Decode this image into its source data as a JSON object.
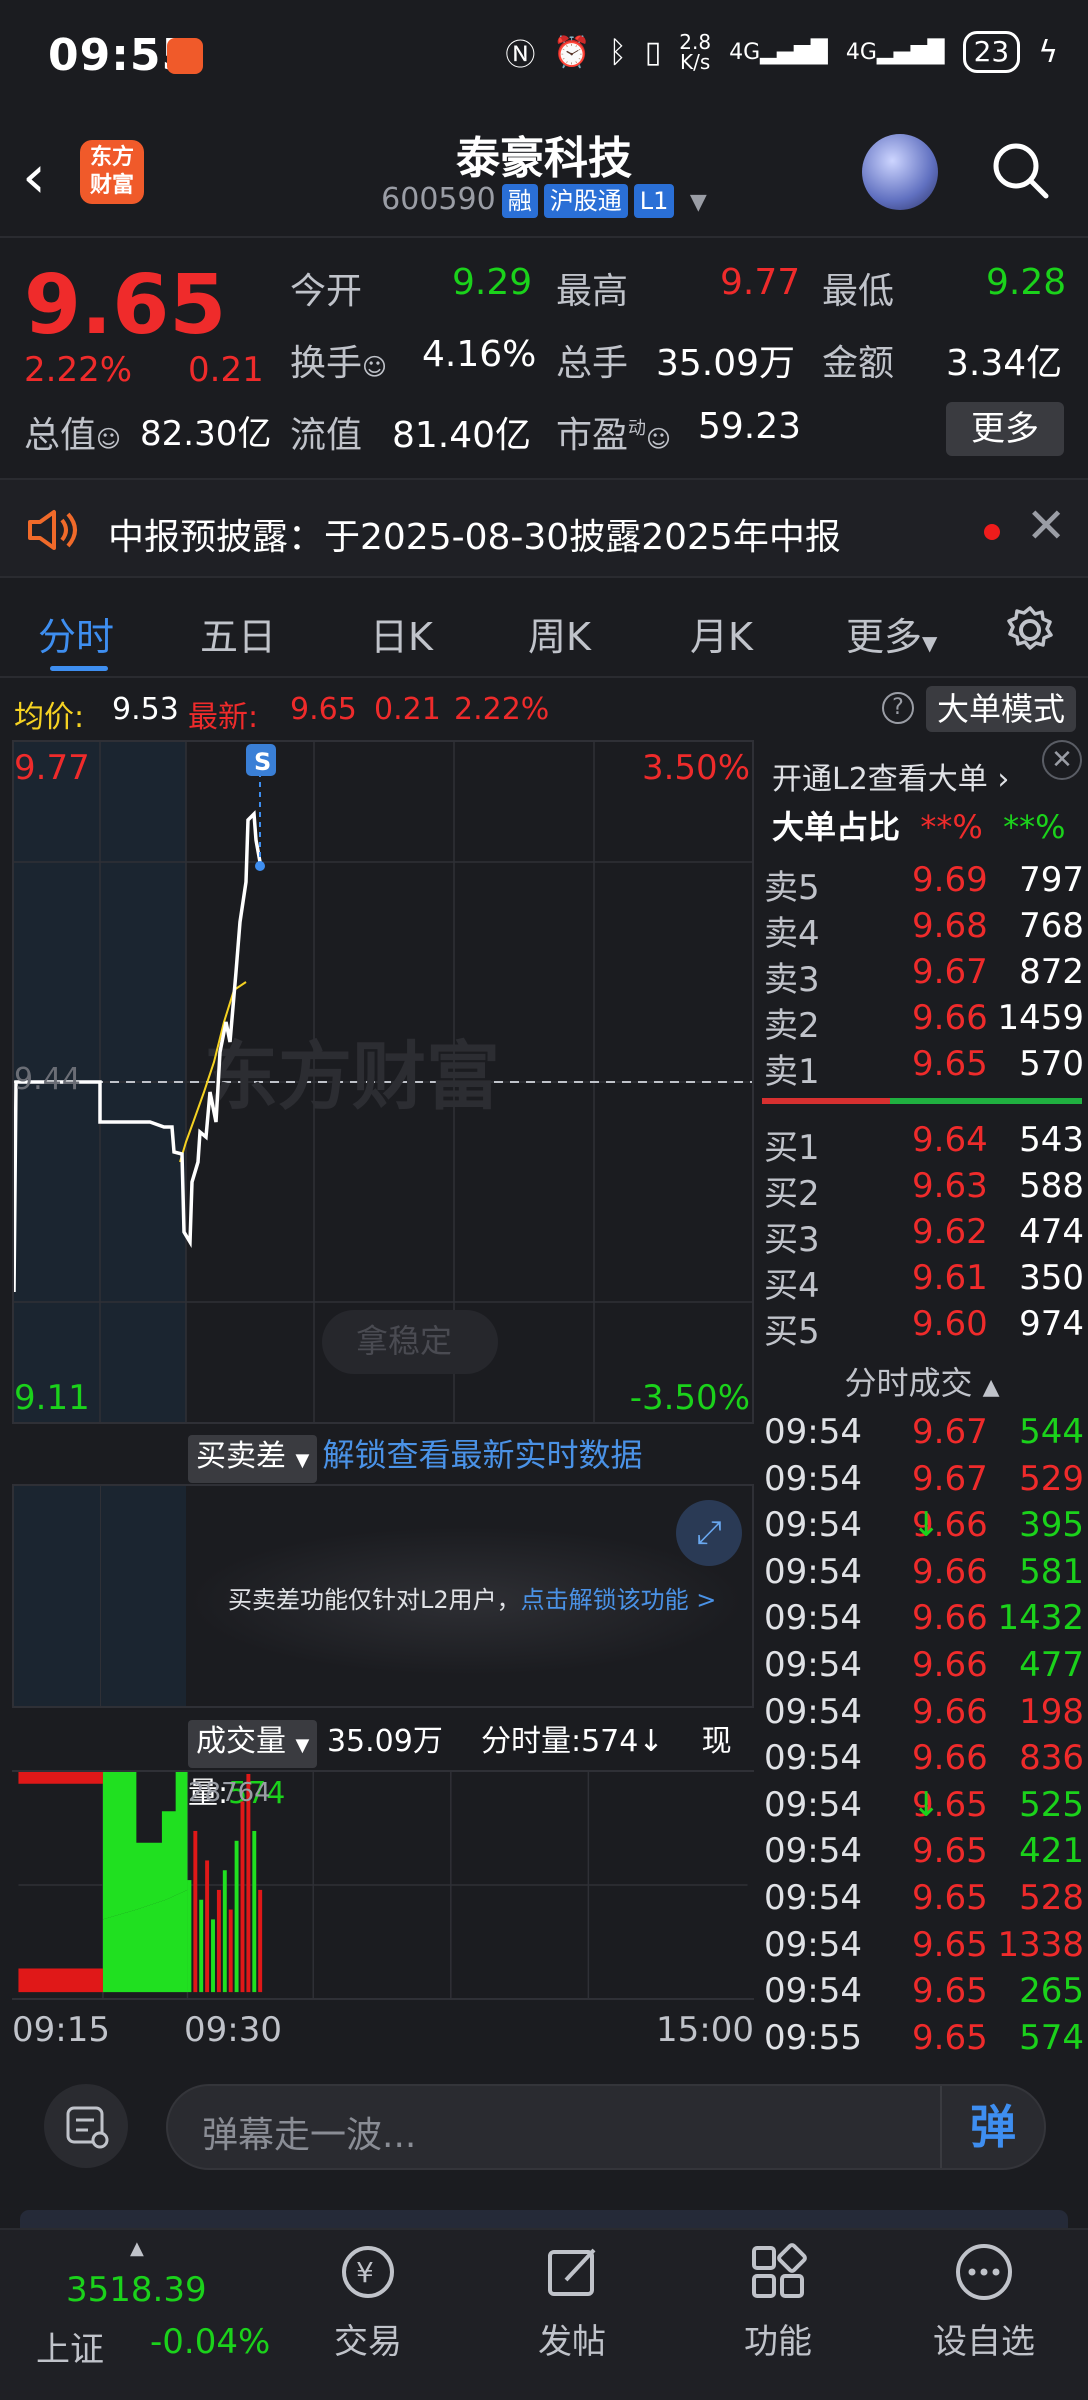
{
  "status": {
    "time": "09:55",
    "speed_top": "2.8",
    "speed_unit": "K/s",
    "signal1": "4G",
    "signal2": "4G",
    "battery": "23"
  },
  "header": {
    "logo_line1": "东方",
    "logo_line2": "财富",
    "stock_name": "泰豪科技",
    "stock_code": "600590",
    "tag1": "融",
    "tag2": "沪股通",
    "tag3": "L1"
  },
  "quote": {
    "price": "9.65",
    "pct": "2.22%",
    "change": "0.21",
    "open_label": "今开",
    "open": "9.29",
    "high_label": "最高",
    "high": "9.77",
    "low_label": "最低",
    "low": "9.28",
    "turnover_label": "换手",
    "turnover": "4.16%",
    "volume_label": "总手",
    "volume": "35.09万",
    "amount_label": "金额",
    "amount": "3.34亿",
    "mktcap_label": "总值",
    "mktcap": "82.30亿",
    "float_label": "流值",
    "float": "81.40亿",
    "pe_label": "市盈",
    "pe_sup": "动",
    "pe": "59.23",
    "more": "更多"
  },
  "notice": {
    "text": "中报预披露：于2025-08-30披露2025年中报"
  },
  "tabs": [
    "分时",
    "五日",
    "日K",
    "周K",
    "月K",
    "更多"
  ],
  "infobar": {
    "avg_label": "均价:",
    "avg": "9.53",
    "last_label": "最新:",
    "last": "9.65",
    "chg": "0.21",
    "pct": "2.22%",
    "big_mode": "大单模式"
  },
  "chart": {
    "top_price": "9.77",
    "top_pct": "3.50%",
    "mid_price": "9.44",
    "bottom_price": "9.11",
    "bottom_pct": "-3.50%",
    "watermark": "东方财富",
    "stabilize": "拿稳定",
    "s_marker": "S"
  },
  "l2": {
    "open_l2": "开通L2查看大单",
    "big_ratio": "大单占比",
    "big_red": "**%",
    "big_green": "**%"
  },
  "orderbook": {
    "asks": [
      {
        "label": "卖5",
        "price": "9.69",
        "qty": "797"
      },
      {
        "label": "卖4",
        "price": "9.68",
        "qty": "768"
      },
      {
        "label": "卖3",
        "price": "9.67",
        "qty": "872"
      },
      {
        "label": "卖2",
        "price": "9.66",
        "qty": "1459"
      },
      {
        "label": "卖1",
        "price": "9.65",
        "qty": "570"
      }
    ],
    "bids": [
      {
        "label": "买1",
        "price": "9.64",
        "qty": "543"
      },
      {
        "label": "买2",
        "price": "9.63",
        "qty": "588"
      },
      {
        "label": "买3",
        "price": "9.62",
        "qty": "474"
      },
      {
        "label": "买4",
        "price": "9.61",
        "qty": "350"
      },
      {
        "label": "买5",
        "price": "9.60",
        "qty": "974"
      }
    ]
  },
  "trades_title": "分时成交",
  "trades": [
    {
      "time": "09:54",
      "price": "9.67",
      "arrow": "",
      "qty": "544",
      "qcolor": "green"
    },
    {
      "time": "09:54",
      "price": "9.67",
      "arrow": "",
      "qty": "529",
      "qcolor": "red"
    },
    {
      "time": "09:54",
      "price": "9.66",
      "arrow": "↓",
      "qty": "395",
      "qcolor": "green"
    },
    {
      "time": "09:54",
      "price": "9.66",
      "arrow": "",
      "qty": "581",
      "qcolor": "green"
    },
    {
      "time": "09:54",
      "price": "9.66",
      "arrow": "",
      "qty": "1432",
      "qcolor": "green"
    },
    {
      "time": "09:54",
      "price": "9.66",
      "arrow": "",
      "qty": "477",
      "qcolor": "green"
    },
    {
      "time": "09:54",
      "price": "9.66",
      "arrow": "",
      "qty": "198",
      "qcolor": "red"
    },
    {
      "time": "09:54",
      "price": "9.66",
      "arrow": "",
      "qty": "836",
      "qcolor": "red"
    },
    {
      "time": "09:54",
      "price": "9.65",
      "arrow": "↓",
      "qty": "525",
      "qcolor": "green"
    },
    {
      "time": "09:54",
      "price": "9.65",
      "arrow": "",
      "qty": "421",
      "qcolor": "green"
    },
    {
      "time": "09:54",
      "price": "9.65",
      "arrow": "",
      "qty": "528",
      "qcolor": "red"
    },
    {
      "time": "09:54",
      "price": "9.65",
      "arrow": "",
      "qty": "1338",
      "qcolor": "red"
    },
    {
      "time": "09:54",
      "price": "9.65",
      "arrow": "",
      "qty": "265",
      "qcolor": "green"
    },
    {
      "time": "09:55",
      "price": "9.65",
      "arrow": "",
      "qty": "574",
      "qcolor": "green"
    }
  ],
  "mmd": {
    "btn": "买卖差",
    "unlock": "解锁查看最新实时数据",
    "msg": "买卖差功能仅针对L2用户，",
    "msg_link": "点击解锁该功能 >"
  },
  "vol": {
    "btn": "成交量",
    "total": "35.09万",
    "min_label": "分时量:",
    "min_val": "574",
    "now_label": "现量:",
    "now_val": "574",
    "peak": "28764",
    "t1": "09:15",
    "t2": "09:30",
    "t3": "15:00"
  },
  "danmu": {
    "placeholder": "弹幕走一波...",
    "btn": "弹"
  },
  "nav": {
    "index_value": "3518.39",
    "index_name": "上证",
    "index_pct": "-0.04%",
    "trade": "交易",
    "post": "发帖",
    "func": "功能",
    "watch": "设自选"
  },
  "colors": {
    "up": "#ef2b2b",
    "down": "#1bd21b",
    "accent": "#3e8ef0",
    "avg_line": "#f5d222"
  }
}
